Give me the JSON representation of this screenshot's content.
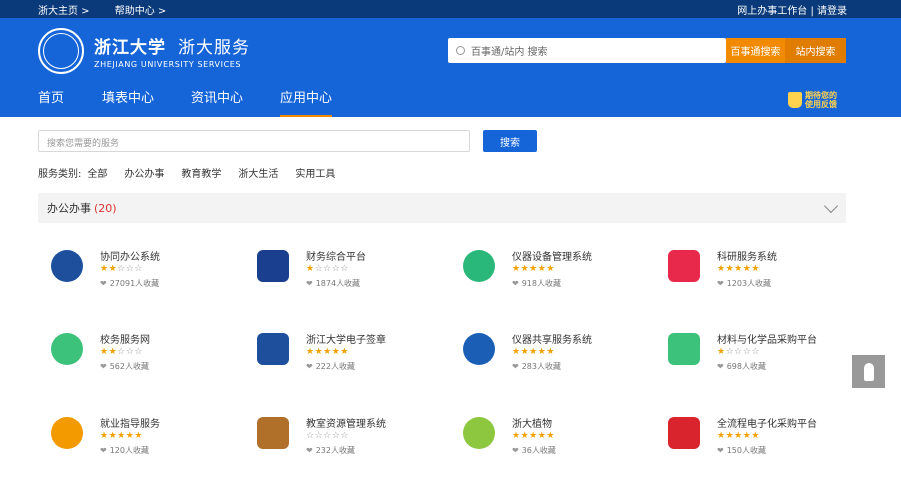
{
  "topbar": {
    "links": [
      "浙大主页 >",
      "帮助中心 >"
    ],
    "right": "网上办事工作台 | 请登录"
  },
  "header": {
    "logo_cn": "浙江大学",
    "logo_service": "浙大服务",
    "logo_en": "ZHEJIANG UNIVERSITY SERVICES",
    "search_placeholder": "百事通/站内 搜索",
    "btn_baishitong": "百事通搜索",
    "btn_site": "站内搜索"
  },
  "nav": {
    "items": [
      "首页",
      "填表中心",
      "资讯中心",
      "应用中心"
    ],
    "active_index": 3,
    "badge": [
      "期待您的",
      "使用反馈"
    ]
  },
  "search": {
    "placeholder": "搜索您需要的服务",
    "button": "搜索"
  },
  "categories": {
    "label": "服务类别:",
    "items": [
      "全部",
      "办公办事",
      "教育教学",
      "浙大生活",
      "实用工具"
    ]
  },
  "section": {
    "title": "办公办事",
    "count": "(20)"
  },
  "services": [
    {
      "name": "协同办公系统",
      "rating": 2,
      "favorites": "27091人收藏",
      "icon": "oa-laptop-icon",
      "color": "#1d4f9c"
    },
    {
      "name": "财务综合平台",
      "rating": 1,
      "favorites": "1874人收藏",
      "icon": "wallet-icon",
      "color": "#1a3f8f"
    },
    {
      "name": "仪器设备管理系统",
      "rating": 5,
      "favorites": "918人收藏",
      "icon": "instrument-icon",
      "color": "#2ab87a"
    },
    {
      "name": "科研服务系统",
      "rating": 5,
      "favorites": "1203人收藏",
      "icon": "atom-icon",
      "color": "#e8294c"
    },
    {
      "name": "校务服务网",
      "rating": 2,
      "favorites": "562人收藏",
      "icon": "people-icon",
      "color": "#3cc27a"
    },
    {
      "name": "浙江大学电子签章",
      "rating": 5,
      "favorites": "222人收藏",
      "icon": "zju-seal-icon",
      "color": "#1d4f9c"
    },
    {
      "name": "仪器共享服务系统",
      "rating": 5,
      "favorites": "283人收藏",
      "icon": "microscope-icon",
      "color": "#1a5fb5"
    },
    {
      "name": "材料与化学品采购平台",
      "rating": 1,
      "favorites": "698人收藏",
      "icon": "cart-icon",
      "color": "#3cc27a"
    },
    {
      "name": "就业指导服务",
      "rating": 5,
      "favorites": "120人收藏",
      "icon": "briefcase-icon",
      "color": "#f29a00"
    },
    {
      "name": "教室资源管理系统",
      "rating": 0,
      "favorites": "232人收藏",
      "icon": "classroom-icon",
      "color": "#b0702a"
    },
    {
      "name": "浙大植物",
      "rating": 5,
      "favorites": "36人收藏",
      "icon": "plant-icon",
      "color": "#8dc63f"
    },
    {
      "name": "全流程电子化采购平台",
      "rating": 5,
      "favorites": "150人收藏",
      "icon": "trolley-icon",
      "color": "#d9232d"
    }
  ]
}
